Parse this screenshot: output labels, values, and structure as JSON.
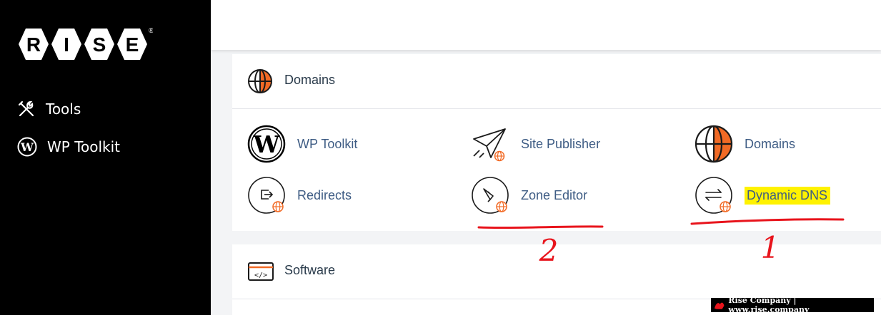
{
  "sidebar": {
    "logo_letters": [
      "R",
      "I",
      "S",
      "E"
    ],
    "logo_mark": "®",
    "items": [
      {
        "label": "Tools",
        "icon": "tools-icon"
      },
      {
        "label": "WP Toolkit",
        "icon": "wordpress-icon"
      }
    ]
  },
  "sections": {
    "domains": {
      "title": "Domains",
      "tools": [
        {
          "label": "WP Toolkit",
          "icon": "wordpress-logo-icon"
        },
        {
          "label": "Site Publisher",
          "icon": "paper-plane-icon"
        },
        {
          "label": "Domains",
          "icon": "globe-icon"
        },
        {
          "label": "Redirects",
          "icon": "redirect-icon"
        },
        {
          "label": "Zone Editor",
          "icon": "zone-editor-icon"
        },
        {
          "label": "Dynamic DNS",
          "icon": "dynamic-dns-icon"
        }
      ]
    },
    "software": {
      "title": "Software"
    }
  },
  "annotations": {
    "mark_2": "2",
    "mark_1": "1"
  },
  "watermark": {
    "text": "Rise Company | www.rise.company"
  },
  "colors": {
    "sidebar": "#000000",
    "accent_orange": "#f26a25",
    "link_blue": "#3e5c84",
    "highlight_yellow": "#fff200",
    "annotation_red": "#e8141c"
  }
}
